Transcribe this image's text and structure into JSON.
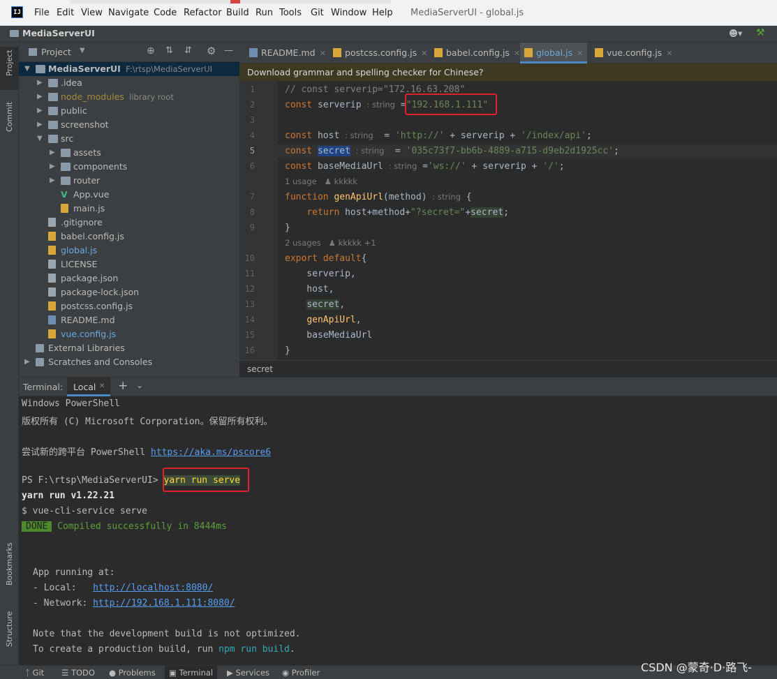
{
  "menubar": {
    "items": [
      "File",
      "Edit",
      "View",
      "Navigate",
      "Code",
      "Refactor",
      "Build",
      "Run",
      "Tools",
      "Git",
      "Window",
      "Help"
    ],
    "window_title": "MediaServerUI - global.js"
  },
  "navbar": {
    "project": "MediaServerUI"
  },
  "left_stripe": {
    "project": "Project",
    "commit": "Commit",
    "bookmarks": "Bookmarks",
    "structure": "Structure"
  },
  "project_panel": {
    "title": "Project",
    "tree": [
      {
        "label": "MediaServerUI",
        "suffix": "F:\\rtsp\\MediaServerUI",
        "depth": 0,
        "type": "folder",
        "expanded": true,
        "selected": true
      },
      {
        "label": ".idea",
        "depth": 1,
        "type": "folder"
      },
      {
        "label": "node_modules",
        "suffix": "library root",
        "depth": 1,
        "type": "folder",
        "color": "#a58c3c"
      },
      {
        "label": "public",
        "depth": 1,
        "type": "folder"
      },
      {
        "label": "screenshot",
        "depth": 1,
        "type": "folder"
      },
      {
        "label": "src",
        "depth": 1,
        "type": "folder",
        "expanded": true
      },
      {
        "label": "assets",
        "depth": 2,
        "type": "folder"
      },
      {
        "label": "components",
        "depth": 2,
        "type": "folder"
      },
      {
        "label": "router",
        "depth": 2,
        "type": "folder"
      },
      {
        "label": "App.vue",
        "depth": 2,
        "type": "vue"
      },
      {
        "label": "main.js",
        "depth": 2,
        "type": "js"
      },
      {
        "label": ".gitignore",
        "depth": 1,
        "type": "file"
      },
      {
        "label": "babel.config.js",
        "depth": 1,
        "type": "js"
      },
      {
        "label": "global.js",
        "depth": 1,
        "type": "js",
        "color": "#6ea8e0"
      },
      {
        "label": "LICENSE",
        "depth": 1,
        "type": "file"
      },
      {
        "label": "package.json",
        "depth": 1,
        "type": "file"
      },
      {
        "label": "package-lock.json",
        "depth": 1,
        "type": "file"
      },
      {
        "label": "postcss.config.js",
        "depth": 1,
        "type": "js"
      },
      {
        "label": "README.md",
        "depth": 1,
        "type": "md"
      },
      {
        "label": "vue.config.js",
        "depth": 1,
        "type": "js",
        "color": "#6ea8e0"
      },
      {
        "label": "External Libraries",
        "depth": 0,
        "type": "lib"
      },
      {
        "label": "Scratches and Consoles",
        "depth": 0,
        "type": "scratch"
      }
    ]
  },
  "editor": {
    "tabs": [
      {
        "label": "README.md",
        "icon": "md"
      },
      {
        "label": "postcss.config.js",
        "icon": "js"
      },
      {
        "label": "babel.config.js",
        "icon": "js"
      },
      {
        "label": "global.js",
        "icon": "js",
        "active": true
      },
      {
        "label": "vue.config.js",
        "icon": "js"
      }
    ],
    "banner": "Download grammar and spelling checker for Chinese?",
    "line_numbers": [
      "1",
      "2",
      "3",
      "4",
      "5",
      "6",
      "7",
      "8",
      "9",
      "10",
      "11",
      "12",
      "13",
      "14",
      "15",
      "16"
    ],
    "lens1": "1 usage",
    "lens1_author": "kkkkk",
    "lens2": "2 usages",
    "lens2_author": "kkkkk +1",
    "breadcrumb": "secret"
  },
  "terminal": {
    "title": "Terminal:",
    "tab": "Local",
    "lines": {
      "l1": "Windows PowerShell",
      "l2": "版权所有 (C) Microsoft Corporation。保留所有权利。",
      "l3_prefix": "尝试新的跨平台 PowerShell ",
      "l3_link": "https://aka.ms/pscore6",
      "prompt": "PS F:\\rtsp\\MediaServerUI> ",
      "command": "yarn run serve",
      "yarn": "yarn run v1.22.21",
      "vue": "$ vue-cli-service serve",
      "done": "DONE",
      "compiled": "Compiled successfully in 8444ms",
      "running": "App running at:",
      "local_label": "- Local:   ",
      "local_url": "http://localhost:8080/",
      "network_label": "- Network: ",
      "network_url": "http://192.168.1.111:8080/",
      "note": "Note that the development build is not optimized.",
      "prod_prefix": "To create a production build, run ",
      "prod_cmd": "npm run build",
      "prod_suffix": "."
    }
  },
  "statusbar": [
    "Git",
    "TODO",
    "Problems",
    "Terminal",
    "Services",
    "Profiler"
  ],
  "watermark": "CSDN @蒙奇·D·路飞-"
}
